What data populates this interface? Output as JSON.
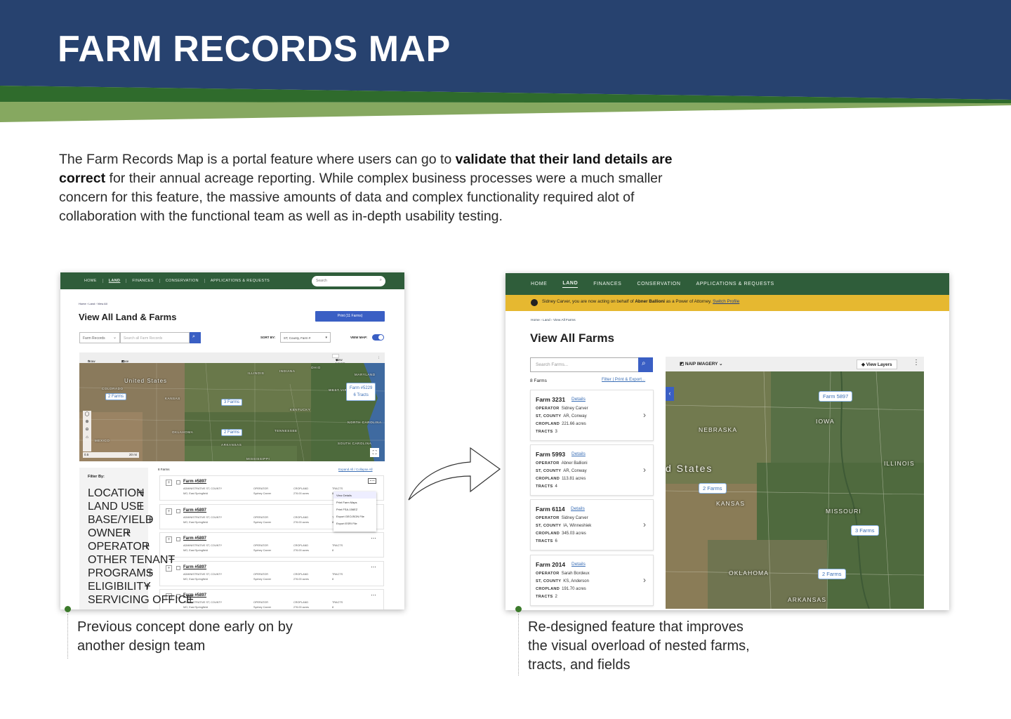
{
  "header": {
    "title": "FARM RECORDS MAP"
  },
  "intro": {
    "part1": "The Farm Records Map is a portal feature where users can go to ",
    "bold": "validate that their land details are correct",
    "part2": " for their annual acreage reporting. While complex business processes were a much smaller concern for this feature, the massive amounts of data and complex functionality required alot of collaboration with the functional team as well as in-depth usability testing."
  },
  "colors": {
    "navy": "#27426f",
    "green": "#2f5d3a",
    "accent_green": "#3c7a2b",
    "banner_yellow": "#e6b830",
    "link_blue": "#3b6fb6",
    "button_blue": "#3a5fc4"
  },
  "old": {
    "nav": [
      "HOME",
      "LAND",
      "FINANCES",
      "CONSERVATION",
      "APPLICATIONS & REQUESTS"
    ],
    "search_placeholder": "Search",
    "breadcrumb": "Home › Land › View All",
    "title": "View All Land & Farms",
    "print_button": "Print (11 Farms)",
    "filter_select": "Farm Records",
    "search_input_placeholder": "Search all Farm Records",
    "sort_label": "SORT BY:",
    "sort_value": "ST, County, Farm #",
    "view_map_label": "VIEW MAP:",
    "draw": "Draw",
    "base_map": "Base Map",
    "view_layers": "View Layers",
    "map_labels": [
      "United States",
      "KANSAS",
      "ILLINOIS",
      "INDIANA",
      "OHIO",
      "KENTUCKY",
      "TENNESSEE",
      "OKLAHOMA",
      "ARKANSAS",
      "MISSISSIPPI",
      "NORTH CAROLINA",
      "SOUTH CAROLINA",
      "WEST VIRGINIA",
      "MARYLAND",
      "COLORADO",
      "MEXICO"
    ],
    "pins": [
      "2 Farms",
      "3 Farms",
      "2 Farms"
    ],
    "farm_pin_title": "Farm #5229",
    "farm_pin_sub": "6 Tracts",
    "scale": "20 mi",
    "scale_zero": "0.5",
    "filter_heading": "Filter By:",
    "filters": [
      "LOCATION",
      "LAND USE",
      "BASE/YIELD",
      "OWNER",
      "OPERATOR",
      "OTHER TENANT",
      "PROGRAMS",
      "ELIGIBILITY",
      "SERVICING OFFICE"
    ],
    "farm_count": "8 Farms",
    "expand_collapse": "Expand All / Collapse All",
    "rows": [
      {
        "title": "Farm #5897",
        "admin_label": "ADMINISTRATIVE ST, COUNTY",
        "admin": "MO, East Springfield",
        "op_label": "OPERATOR",
        "op": "Sydney Carver",
        "crop_label": "CROPLAND",
        "crop": "276.00 acres",
        "tracts_label": "TRACTS",
        "tracts": "8"
      },
      {
        "title": "Farm #5897",
        "admin_label": "ADMINISTRATIVE ST, COUNTY",
        "admin": "MO, East Springfield",
        "op_label": "OPERATOR",
        "op": "Sydney Carver",
        "crop_label": "CROPLAND",
        "crop": "276.00 acres",
        "tracts_label": "TRACTS",
        "tracts": "8"
      },
      {
        "title": "Farm #5897",
        "admin_label": "ADMINISTRATIVE ST, COUNTY",
        "admin": "MO, East Springfield",
        "op_label": "OPERATOR",
        "op": "Sydney Carver",
        "crop_label": "CROPLAND",
        "crop": "276.00 acres",
        "tracts_label": "TRACTS",
        "tracts": "8"
      },
      {
        "title": "Farm #5897",
        "admin_label": "ADMINISTRATIVE ST, COUNTY",
        "admin": "MO, East Springfield",
        "op_label": "OPERATOR",
        "op": "Sydney Carver",
        "crop_label": "CROPLAND",
        "crop": "276.00 acres",
        "tracts_label": "TRACTS",
        "tracts": "8"
      },
      {
        "title": "Farm #5897",
        "admin_label": "ADMINISTRATIVE ST, COUNTY",
        "admin": "MO, East Springfield",
        "op_label": "OPERATOR",
        "op": "Sydney Carver",
        "crop_label": "CROPLAND",
        "crop": "276.00 acres",
        "tracts_label": "TRACTS",
        "tracts": "8"
      }
    ],
    "menu": [
      "View Details",
      "Print Farm Maps",
      "Print FSA-156EZ",
      "Export GEOJSON File",
      "Export ESRI File"
    ]
  },
  "new": {
    "nav": [
      "HOME",
      "LAND",
      "FINANCES",
      "CONSERVATION",
      "APPLICATIONS & REQUESTS"
    ],
    "banner_pre": "Sidney Carver, you are now acting on behalf of ",
    "banner_name": "Abner Ballioni",
    "banner_post": " as a Power of Attorney. ",
    "banner_link": "Switch Profile",
    "breadcrumb": "Home › Land › View All Farms",
    "title": "View All Farms",
    "search_placeholder": "Search Farms...",
    "farm_count": "8 Farms",
    "links": "Filter | Print & Export...",
    "imagery": "NAIP IMAGERY",
    "view_layers": "View Layers",
    "cards": [
      {
        "title": "Farm 3231",
        "details": "Details",
        "operator": "Sidney Carver",
        "county": "AR, Conway",
        "cropland": "221.66 acres",
        "tracts": "3"
      },
      {
        "title": "Farm 5993",
        "details": "Details",
        "operator": "Abner Ballioni",
        "county": "AR, Conway",
        "cropland": "113.81 acres",
        "tracts": "4"
      },
      {
        "title": "Farm 6114",
        "details": "Details",
        "operator": "Sidney Carver",
        "county": "IA, Winneshiek",
        "cropland": "345.03 acres",
        "tracts": "6"
      },
      {
        "title": "Farm 2014",
        "details": "Details",
        "operator": "Sarah Bordeux",
        "county": "KS, Anderson",
        "cropland": "191.70 acres",
        "tracts": "2"
      }
    ],
    "labels": {
      "operator": "OPERATOR",
      "county": "ST, COUNTY",
      "cropland": "CROPLAND",
      "tracts": "TRACTS"
    },
    "map_labels": [
      "NEBRASKA",
      "IOWA",
      "ILLINOIS",
      "d States",
      "KANSAS",
      "MISSOURI",
      "OKLAHOMA",
      "ARKANSAS"
    ],
    "pins": [
      "Farm 5897",
      "2 Farms",
      "3 Farms",
      "2 Farms"
    ]
  },
  "captions": {
    "left": [
      "Previous concept done early on by",
      "another design team"
    ],
    "right": [
      "Re-designed feature that improves",
      "the visual overload of nested farms,",
      "tracts, and fields"
    ]
  }
}
